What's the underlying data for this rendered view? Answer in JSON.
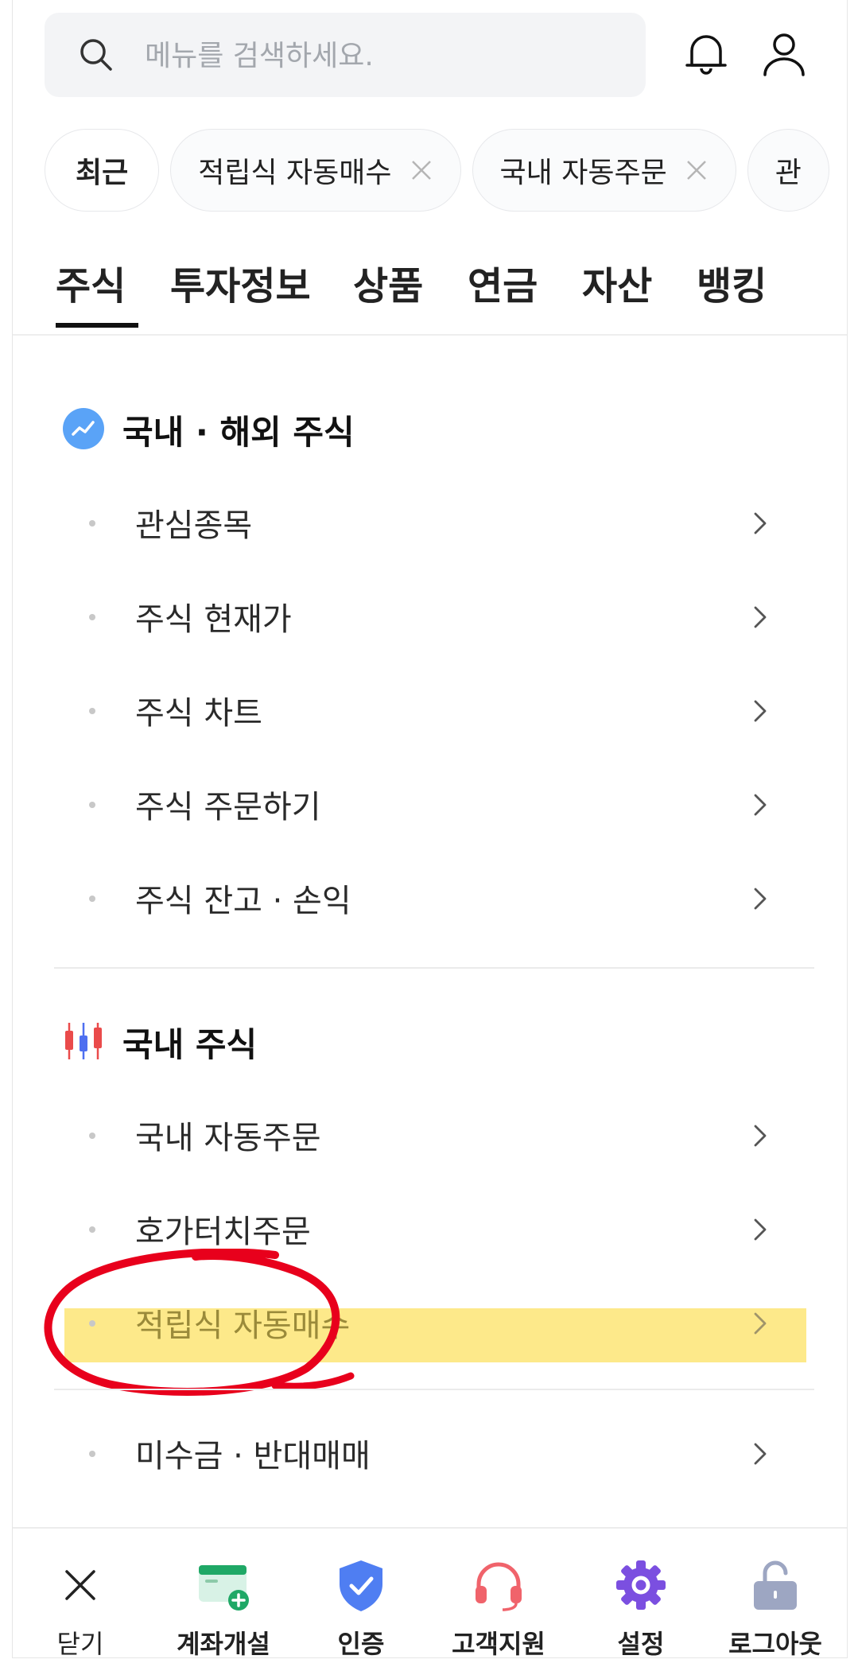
{
  "search": {
    "placeholder": "메뉴를 검색하세요."
  },
  "chips": [
    {
      "label": "최근"
    },
    {
      "label": "적립식 자동매수"
    },
    {
      "label": "국내 자동주문"
    },
    {
      "label": "관"
    }
  ],
  "tabs": [
    "주식",
    "투자정보",
    "상품",
    "연금",
    "자산",
    "뱅킹"
  ],
  "sections": [
    {
      "title": "국내 · 해외 주식",
      "icon": "chart-badge-icon",
      "items": [
        "관심종목",
        "주식 현재가",
        "주식 차트",
        "주식 주문하기",
        "주식 잔고 · 손익"
      ]
    },
    {
      "title": "국내 주식",
      "icon": "candlestick-icon",
      "items": [
        "국내 자동주문",
        "호가터치주문",
        "적립식 자동매수",
        "미수금 · 반대매매"
      ]
    }
  ],
  "highlight_color": "#fde98a",
  "annotation_color": "#e8001c",
  "bottom_bar": [
    {
      "label": "닫기",
      "icon": "close-icon"
    },
    {
      "label": "계좌개설",
      "icon": "account-card-icon"
    },
    {
      "label": "인증",
      "icon": "shield-check-icon"
    },
    {
      "label": "고객지원",
      "icon": "headset-icon"
    },
    {
      "label": "설정",
      "icon": "gear-icon"
    },
    {
      "label": "로그아웃",
      "icon": "unlock-icon"
    }
  ]
}
